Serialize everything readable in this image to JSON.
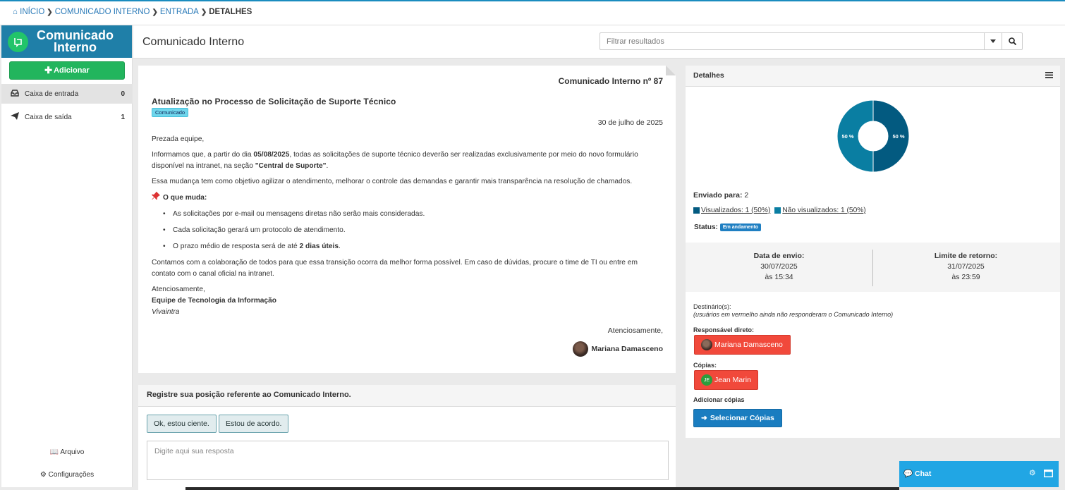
{
  "breadcrumb": {
    "items": [
      "INÍCIO",
      "COMUNICADO INTERNO",
      "ENTRADA"
    ],
    "current": "DETALHES"
  },
  "sidebar": {
    "app_title_line1": "Comunicado",
    "app_title_line2": "Interno",
    "add_label": "Adicionar",
    "items": [
      {
        "label": "Caixa de entrada",
        "count": "0",
        "icon": "inbox-icon"
      },
      {
        "label": "Caixa de saída",
        "count": "1",
        "icon": "paper-plane-icon"
      }
    ],
    "footer": {
      "archive": "Arquivo",
      "settings": "Configurações"
    }
  },
  "header": {
    "title": "Comunicado Interno",
    "filter_placeholder": "Filtrar resultados"
  },
  "communication": {
    "number": "Comunicado Interno nº 87",
    "subject": "Atualização no Processo de Solicitação de Suporte Técnico",
    "tag": "Comunicado",
    "date": "30 de julho de 2025",
    "greeting": "Prezada equipe,",
    "p1_before": "Informamos que, a partir do dia ",
    "p1_date": "05/08/2025",
    "p1_middle": ", todas as solicitações de suporte técnico deverão ser realizadas exclusivamente por meio do novo formulário disponível na intranet, na seção ",
    "p1_section": "\"Central de Suporte\"",
    "p1_end": ".",
    "p2": "Essa mudança tem como objetivo agilizar o atendimento, melhorar o controle das demandas e garantir mais transparência na resolução de chamados.",
    "section_title": "O que muda:",
    "bullet1": "As solicitações por e-mail ou mensagens diretas não serão mais consideradas.",
    "bullet2": "Cada solicitação gerará um protocolo de atendimento.",
    "bullet3_before": "O prazo médio de resposta será de até ",
    "bullet3_bold": "2 dias úteis",
    "bullet3_end": ".",
    "p3": "Contamos com a colaboração de todos para que essa transição ocorra da melhor forma possível. Em caso de dúvidas, procure o time de TI ou entre em contato com o canal oficial na intranet.",
    "closing": "Atenciosamente,",
    "team": "Equipe de Tecnologia da Informação",
    "company": "Vivaintra",
    "signoff": "Atenciosamente,",
    "sender": "Mariana Damasceno"
  },
  "response": {
    "title": "Registre sua posição referente ao Comunicado Interno.",
    "btn_aware": "Ok, estou ciente.",
    "btn_agree": "Estou de acordo.",
    "placeholder": "Digite aqui sua resposta"
  },
  "details": {
    "title": "Detalhes",
    "sent_to_label": "Enviado para:",
    "sent_to_value": "2",
    "legend_viewed": "Visualizados: 1 (50%)",
    "legend_not_viewed": "Não visualizados: 1 (50%)",
    "status_label": "Status:",
    "status_value": "Em andamento",
    "send_date_label": "Data de envio:",
    "send_date": "30/07/2025",
    "send_time": "às 15:34",
    "return_label": "Limite de retorno:",
    "return_date": "31/07/2025",
    "return_time": "às 23:59",
    "recipients_label": "Destinário(s):",
    "recipients_note": "(usuários em vermelho ainda não responderam o Comunicado Interno)",
    "direct_label": "Responsável direto:",
    "direct_person": "Mariana Damasceno",
    "copies_label": "Cópias:",
    "copy_person": "Jean Marin",
    "copy_initials": "JE",
    "add_copies_label": "Adicionar cópias",
    "select_copies_btn": "Selecionar Cópias"
  },
  "chart_data": {
    "type": "pie",
    "categories": [
      "Visualizados",
      "Não visualizados"
    ],
    "values": [
      50,
      50
    ],
    "labels": [
      "50 %",
      "50 %"
    ],
    "colors": [
      "#035a80",
      "#0a7ea2"
    ]
  },
  "chat": {
    "label": "Chat"
  },
  "colors": {
    "brand": "#1f7fa8",
    "add_green": "#22b55d",
    "pending_red": "#f1493b",
    "action_blue": "#1a7dc0",
    "chat_blue": "#21a6e4"
  }
}
